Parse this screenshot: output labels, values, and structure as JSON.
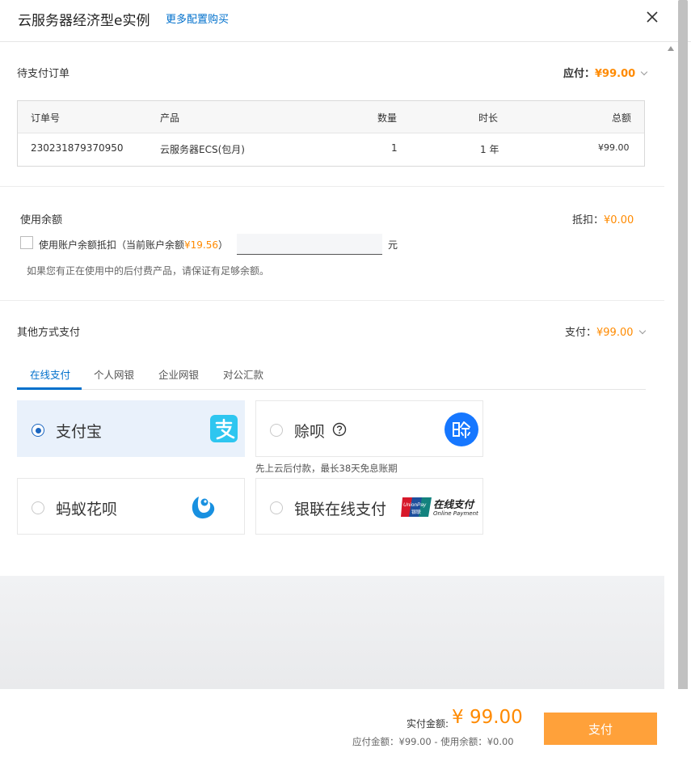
{
  "header": {
    "title": "云服务器经济型e实例",
    "more_link": "更多配置购买"
  },
  "order_section": {
    "title": "待支付订单",
    "due_label": "应付：",
    "due_amount": "¥99.00",
    "table": {
      "headers": [
        "订单号",
        "产品",
        "数量",
        "时长",
        "总额"
      ],
      "row": [
        "230231879370950",
        "云服务器ECS(包月)",
        "1",
        "1 年",
        "¥99.00"
      ]
    }
  },
  "balance_section": {
    "title": "使用余额",
    "deduct_label": "抵扣：",
    "deduct_amount": "¥0.00",
    "checkbox_label_prefix": "使用账户余额抵扣（当前账户余额",
    "checkbox_balance": "¥19.56",
    "checkbox_label_suffix": "）",
    "input_value": "",
    "unit": "元",
    "note": "如果您有正在使用中的后付费产品，请保证有足够余额。"
  },
  "other_payment": {
    "title": "其他方式支付",
    "pay_label": "支付：",
    "pay_amount": "¥99.00",
    "tabs": [
      "在线支付",
      "个人网银",
      "企业网银",
      "对公汇款"
    ],
    "active_tab": 0,
    "methods": [
      {
        "label": "支付宝",
        "selected": true,
        "icon": "alipay-icon"
      },
      {
        "label": "赊呗",
        "selected": false,
        "icon": "shebei-icon",
        "note": "先上云后付款，最长38天免息账期"
      },
      {
        "label": "蚂蚁花呗",
        "selected": false,
        "icon": "huabei-icon"
      },
      {
        "label": "银联在线支付",
        "selected": false,
        "icon": "unionpay-icon"
      }
    ],
    "unionpay_text": "在线支付",
    "unionpay_subtext": "Online Payment",
    "unionpay_badge": "UnionPay",
    "unionpay_badge_cn": "银联"
  },
  "footer": {
    "actual_label": "实付金额:",
    "actual_amount": "¥ 99.00",
    "breakdown": "应付金额：¥99.00 - 使用余额：¥0.00",
    "pay_button": "支付"
  },
  "colors": {
    "accent_blue": "#0070cc",
    "price_orange": "#ff8a00",
    "pay_button": "#ffa13a",
    "selected_card": "#e9f1fb"
  }
}
